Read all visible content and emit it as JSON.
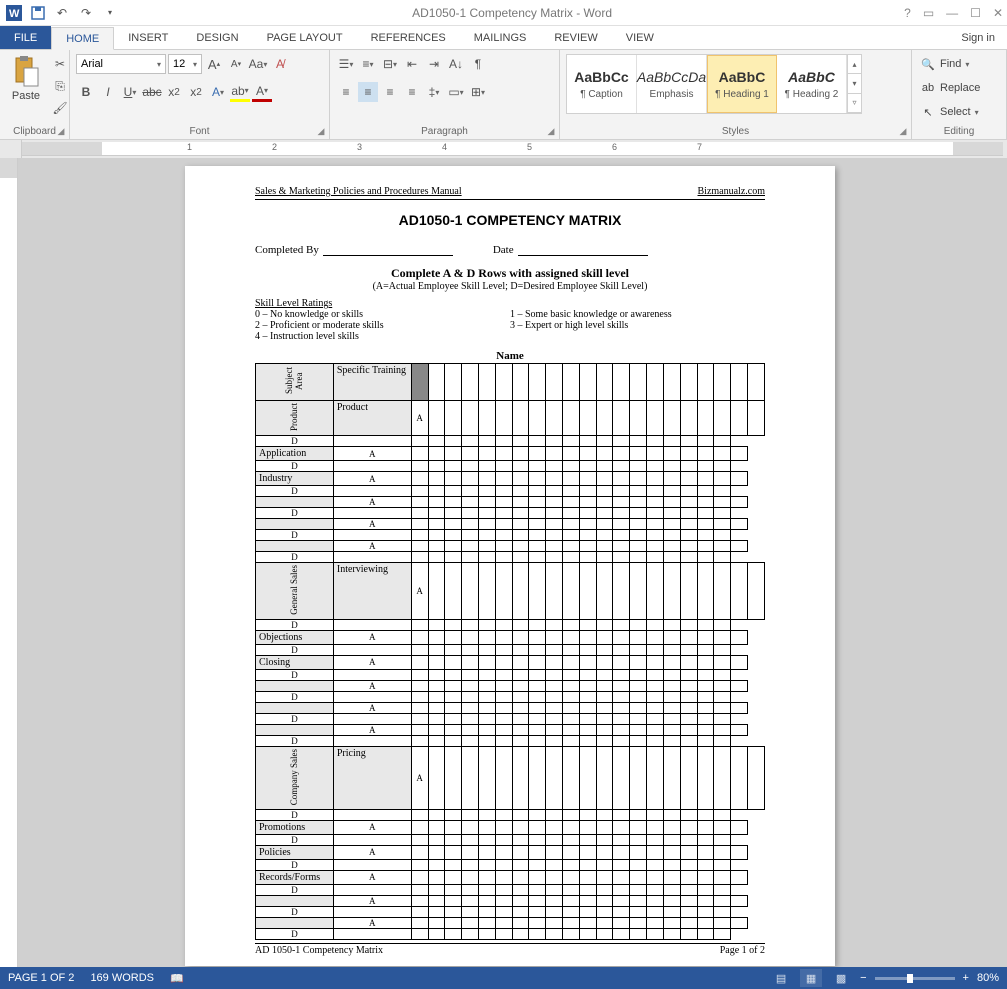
{
  "titlebar": {
    "title": "AD1050-1 Competency Matrix - Word"
  },
  "tabs": {
    "file": "FILE",
    "home": "HOME",
    "insert": "INSERT",
    "design": "DESIGN",
    "page_layout": "PAGE LAYOUT",
    "references": "REFERENCES",
    "mailings": "MAILINGS",
    "review": "REVIEW",
    "view": "VIEW",
    "signin": "Sign in"
  },
  "ribbon": {
    "clipboard": {
      "label": "Clipboard",
      "paste": "Paste"
    },
    "font": {
      "label": "Font",
      "name": "Arial",
      "size": "12"
    },
    "paragraph": {
      "label": "Paragraph"
    },
    "styles": {
      "label": "Styles",
      "items": [
        {
          "preview": "AaBbCc",
          "name": "¶ Caption",
          "bold": true
        },
        {
          "preview": "AaBbCcDa",
          "name": "Emphasis",
          "italic": true
        },
        {
          "preview": "AaBbC",
          "name": "¶ Heading 1",
          "bold": true
        },
        {
          "preview": "AaBbC",
          "name": "¶ Heading 2",
          "italic": true,
          "bold": true
        }
      ],
      "selected": 2
    },
    "editing": {
      "label": "Editing",
      "find": "Find",
      "replace": "Replace",
      "select": "Select"
    }
  },
  "ruler": {
    "ticks": [
      "1",
      "2",
      "3",
      "4",
      "5",
      "6",
      "7"
    ]
  },
  "document": {
    "header_left": "Sales & Marketing Policies and Procedures Manual",
    "header_right": "Bizmanualz.com",
    "title": "AD1050-1 COMPETENCY MATRIX",
    "completed_by": "Completed By",
    "date": "Date",
    "instruction": "Complete A & D Rows with assigned skill level",
    "instruction_sub": "(A=Actual Employee Skill Level; D=Desired Employee Skill Level)",
    "ratings_header": "Skill Level Ratings",
    "ratings_left": [
      "0 – No knowledge or skills",
      "2 – Proficient or moderate skills",
      "4 – Instruction level skills"
    ],
    "ratings_right": [
      "1 – Some basic knowledge or awareness",
      "3 – Expert or high level skills"
    ],
    "name_header": "Name",
    "subject_area_label": "Subject Area",
    "specific_training_label": "Specific Training",
    "sections": [
      {
        "subject": "Product",
        "topics": [
          "Product",
          "Application",
          "Industry",
          "",
          "",
          ""
        ]
      },
      {
        "subject": "General Sales",
        "topics": [
          "Interviewing",
          "Objections",
          "Closing",
          "",
          "",
          ""
        ]
      },
      {
        "subject": "Company Sales",
        "topics": [
          "Pricing",
          "Promotions",
          "Policies",
          "Records/Forms",
          "",
          ""
        ]
      }
    ],
    "ad_labels": {
      "a": "A",
      "d": "D"
    },
    "footer_left": "AD 1050-1 Competency Matrix",
    "footer_right": "Page 1 of 2"
  },
  "statusbar": {
    "page": "PAGE 1 OF 2",
    "words": "169 WORDS",
    "zoom": "80%"
  }
}
